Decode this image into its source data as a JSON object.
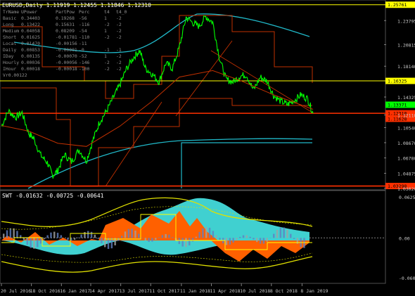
{
  "chart_title": "EURUSD,Daily  1.11919 1.12455 1.11846 1.12310",
  "indicator_title": "SWT  -0.01632  -0.00725  -0.00641",
  "colors": {
    "background": "#000000",
    "price_line": "#00ff00",
    "accent_teal": "#20b8c8",
    "trend_red": "#c03000",
    "level_yellow": "#ffff00",
    "level_red": "#ff3000",
    "price_tag_green": "#00ff00",
    "price_tag_red": "#ff3000",
    "osc_fill_cyan": "#40d0d0",
    "osc_fill_orange": "#ff6000",
    "osc_fill_gray": "#a0a0a0",
    "osc_fill_blue": "#6080c0",
    "envelope_yellow": "#e0e000"
  },
  "info_table": {
    "headers": [
      "TrName",
      "UPower",
      "PartPow",
      "Perc",
      "t4",
      "t4_0"
    ],
    "rows": [
      [
        "Basic",
        "0.34403",
        "0.19268",
        "-56",
        "1",
        "-2"
      ],
      [
        "Long",
        "0.13422",
        "0.15631",
        "-116",
        "-2",
        "-2"
      ],
      [
        "Medium",
        "0.04058",
        "0.08209",
        "-54",
        "1",
        "-2"
      ],
      [
        "Short",
        "0.01625",
        "-0.01781",
        "-110",
        "-2",
        "-2"
      ],
      [
        "Local",
        "0.01470",
        "-0.00156",
        "-11",
        "",
        ""
      ],
      [
        "Daily",
        "0.00853",
        "-0.00001",
        "-0",
        "-1",
        "-1"
      ],
      [
        "IDay",
        "0.00135",
        "-0.00070",
        "-52",
        "1",
        "-2"
      ],
      [
        "Hourly",
        "0.00036",
        "-0.00056",
        "-146",
        "-2",
        "-2"
      ],
      [
        "IHour",
        "0.00018",
        "-0.00018",
        "-100",
        "-2",
        "-2"
      ]
    ],
    "footer": "Vr0.00122"
  },
  "price_levels": [
    {
      "price": 1.25761,
      "label": "1.25761",
      "color": "#ffff00"
    },
    {
      "price": 1.16325,
      "label": "1.16325",
      "color": "#ffff00"
    },
    {
      "price": 1.1231,
      "label": "1.12310",
      "color": "#ff3000"
    },
    {
      "price": 1.03298,
      "label": "1.03298",
      "color": "#ff3000"
    }
  ],
  "price_tags": [
    {
      "label": "1.13371",
      "color": "#00ff00"
    },
    {
      "label": "1.11628",
      "color": "#ff3000"
    }
  ],
  "chart_data": {
    "type": "line",
    "title": "EURUSD,Daily",
    "y_ticks": [
      1.23795,
      1.20815,
      1.1814,
      1.14325,
      1.1211,
      1.1054,
      1.0867,
      1.0678,
      1.04875,
      1.0302
    ],
    "ylim": [
      1.03,
      1.26
    ],
    "x_ticks": [
      "20 Jul 2016",
      "18 Oct 2016",
      "16 Jan 2017",
      "14 Apr 2017",
      "13 Jul 2017",
      "11 Oct 2017",
      "11 Jan 2018",
      "11 Apr 2018",
      "10 Jul 2018",
      "8 Oct 2018",
      "8 Jan 2019"
    ],
    "series": [
      {
        "x": [
          "2016-07-20",
          "2016-08-10",
          "2016-09-01",
          "2016-09-20",
          "2016-10-10",
          "2016-10-25",
          "2016-11-15",
          "2016-12-05",
          "2016-12-20",
          "2017-01-05",
          "2017-01-25",
          "2017-02-15",
          "2017-03-10",
          "2017-04-01",
          "2017-04-20",
          "2017-05-10",
          "2017-05-30",
          "2017-06-20",
          "2017-07-10",
          "2017-07-30",
          "2017-08-20",
          "2017-09-08",
          "2017-09-25",
          "2017-10-15",
          "2017-11-05",
          "2017-11-25",
          "2017-12-15",
          "2018-01-05",
          "2018-01-25",
          "2018-02-15",
          "2018-03-05",
          "2018-03-25",
          "2018-04-15",
          "2018-05-05",
          "2018-05-25",
          "2018-06-15",
          "2018-07-05",
          "2018-07-25",
          "2018-08-15",
          "2018-09-05",
          "2018-09-25",
          "2018-10-15",
          "2018-11-05",
          "2018-11-25",
          "2018-12-15",
          "2019-01-05",
          "2019-01-25",
          "2019-02-10"
        ],
        "values": [
          1.107,
          1.126,
          1.118,
          1.124,
          1.098,
          1.092,
          1.071,
          1.062,
          1.046,
          1.052,
          1.072,
          1.063,
          1.078,
          1.064,
          1.089,
          1.112,
          1.125,
          1.142,
          1.158,
          1.178,
          1.192,
          1.201,
          1.179,
          1.172,
          1.162,
          1.185,
          1.179,
          1.205,
          1.242,
          1.235,
          1.231,
          1.243,
          1.236,
          1.192,
          1.165,
          1.162,
          1.169,
          1.171,
          1.152,
          1.168,
          1.163,
          1.145,
          1.138,
          1.134,
          1.139,
          1.146,
          1.141,
          1.123
        ]
      },
      {
        "name": "",
        "x": [
          "2016-07-20",
          "2016-10-10",
          "2017-01-05",
          "2017-04-01",
          "2017-07-10",
          "2017-10-15",
          "2018-01-05",
          "2018-04-15",
          "2018-07-05",
          "2018-10-15",
          "2019-02-10"
        ],
        "values": [
          1.108,
          1.101,
          1.086,
          1.082,
          1.107,
          1.138,
          1.168,
          1.176,
          1.164,
          1.146,
          1.128
        ]
      }
    ],
    "xlabel": "",
    "ylabel": ""
  },
  "oscillator": {
    "y_ticks": [
      {
        "value": 0.0625,
        "label": "0.0625"
      },
      {
        "value": 0.0,
        "label": "0.00"
      },
      {
        "value": -0.0605,
        "label": "-0.0605"
      }
    ],
    "ylim": [
      -0.067,
      0.07
    ]
  }
}
